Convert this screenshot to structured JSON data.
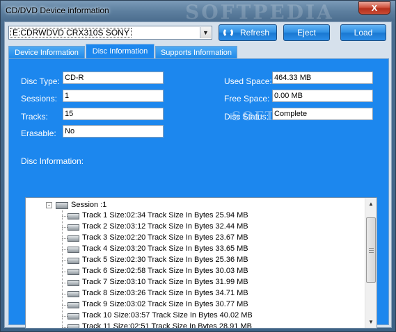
{
  "window": {
    "title": "CD/DVD Device information",
    "watermark": "SOFTPEDIA",
    "close_label": "X"
  },
  "toolbar": {
    "drive_value": "E:CDRWDVD CRX310S SONY",
    "refresh_label": "Refresh",
    "eject_label": "Eject",
    "load_label": "Load"
  },
  "tabs": [
    {
      "label": "Device Information",
      "selected": false
    },
    {
      "label": "Disc Information",
      "selected": true
    },
    {
      "label": "Supports Information",
      "selected": false
    }
  ],
  "disc": {
    "disc_type_label": "Disc Type:",
    "disc_type_value": "CD-R",
    "sessions_label": "Sessions:",
    "sessions_value": "1",
    "tracks_label": "Tracks:",
    "tracks_value": "15",
    "erasable_label": "Erasable:",
    "erasable_value": "No",
    "used_space_label": "Used Space:",
    "used_space_value": "464.33 MB",
    "free_space_label": "Free Space:",
    "free_space_value": "0.00 MB",
    "disc_status_label": "Disc Status:",
    "disc_status_value": "Complete",
    "disc_information_label": "Disc Information:"
  },
  "tree": {
    "session_label": "Session :1",
    "expander": "-",
    "tracks": [
      "Track 1 Size:02:34 Track Size In Bytes 25.94 MB",
      "Track 2 Size:03:12 Track Size In Bytes 32.44 MB",
      "Track 3 Size:02:20 Track Size In Bytes 23.67 MB",
      "Track 4 Size:03:20 Track Size In Bytes 33.65 MB",
      "Track 5 Size:02:30 Track Size In Bytes 25.36 MB",
      "Track 6 Size:02:58 Track Size In Bytes 30.03 MB",
      "Track 7 Size:03:10 Track Size In Bytes 31.99 MB",
      "Track 8 Size:03:26 Track Size In Bytes 34.71 MB",
      "Track 9 Size:03:02 Track Size In Bytes 30.77 MB",
      "Track 10 Size:03:57 Track Size In Bytes 40.02 MB",
      "Track 11 Size:02:51 Track Size In Bytes 28.91 MB"
    ]
  },
  "colors": {
    "panel_blue": "#1c87ee",
    "button_blue": "#2e8fe4",
    "close_red": "#c84a34"
  }
}
